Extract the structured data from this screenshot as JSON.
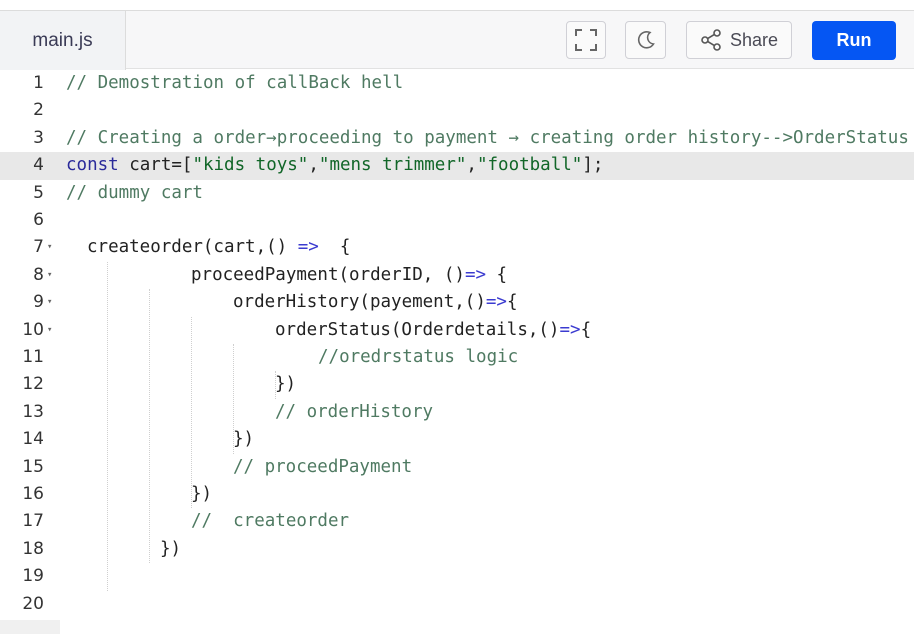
{
  "tab": {
    "filename": "main.js"
  },
  "toolbar": {
    "share_label": "Share",
    "run_label": "Run",
    "icons": [
      "fullscreen-icon",
      "moon-icon",
      "share-icon"
    ]
  },
  "colors": {
    "run_button": "#0556f3",
    "comment": "#4f7a62",
    "string": "#116628",
    "keyword": "#2a2a9a"
  },
  "editor": {
    "active_line": 4,
    "lines": [
      {
        "n": "1",
        "c": "// Demostration of callBack hell"
      },
      {
        "n": "2",
        "c": ""
      },
      {
        "n": "3",
        "c": "// Creating a order→proceeding to payment → creating order history-->OrderStatus"
      },
      {
        "n": "4",
        "c": "const cart=[\"kids toys\",\"mens trimmer\",\"football\"];"
      },
      {
        "n": "5",
        "c": "// dummy cart"
      },
      {
        "n": "6",
        "c": ""
      },
      {
        "n": "7",
        "c": "createorder(cart,() =>  {"
      },
      {
        "n": "8",
        "c": "proceedPayment(orderID, ()=> {"
      },
      {
        "n": "9",
        "c": "orderHistory(payement,()=>{"
      },
      {
        "n": "10",
        "c": "orderStatus(Orderdetails,()=>{"
      },
      {
        "n": "11",
        "c": "//oredrstatus logic"
      },
      {
        "n": "12",
        "c": "})"
      },
      {
        "n": "13",
        "c": "// orderHistory"
      },
      {
        "n": "14",
        "c": "})"
      },
      {
        "n": "15",
        "c": "// proceedPayment"
      },
      {
        "n": "16",
        "c": "})"
      },
      {
        "n": "17",
        "c": "//  createorder"
      },
      {
        "n": "18",
        "c": "})"
      },
      {
        "n": "19",
        "c": ""
      },
      {
        "n": "20",
        "c": ""
      }
    ]
  }
}
